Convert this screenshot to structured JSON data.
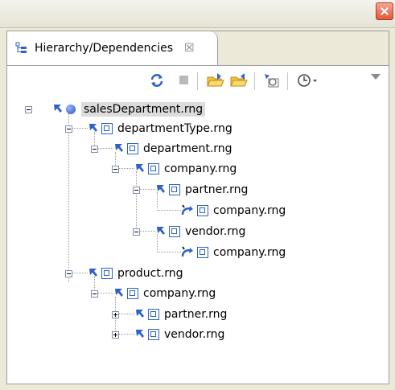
{
  "tab": {
    "label": "Hierarchy/Dependencies",
    "close_glyph": "☒"
  },
  "colors": {
    "accent": "#2e62c8",
    "selection": "#dcdcdc",
    "close": "#e0583c"
  },
  "toolbar": {
    "buttons": [
      "refresh-icon",
      "stop-icon",
      "open-folder-icon",
      "open-folder-icon-2",
      "search-icon",
      "history-icon"
    ]
  },
  "tree": {
    "root": "salesDepartment.rng",
    "n1": "departmentType.rng",
    "n2": "department.rng",
    "n3": "company.rng",
    "n4": "partner.rng",
    "n5": "company.rng",
    "n6": "vendor.rng",
    "n7": "company.rng",
    "n8": "product.rng",
    "n9": "company.rng",
    "n10": "partner.rng",
    "n11": "vendor.rng"
  }
}
